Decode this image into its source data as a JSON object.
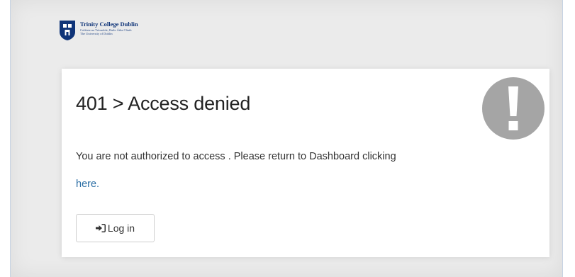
{
  "brand": {
    "name": "Trinity College Dublin",
    "irish_name": "Coláiste na Tríonóide, Baile Átha Cliath",
    "subtitle": "The University of Dublin",
    "color": "#0f3478"
  },
  "error": {
    "title": "401 > Access denied",
    "icon": "exclamation-circle-icon",
    "icon_color": "#a5a5a5",
    "message": "You are not authorized to access . Please return to Dashboard clicking",
    "link_text": "here.",
    "link_color": "#2b6ea4"
  },
  "login_button": {
    "label": "Log in",
    "icon": "sign-in-icon"
  }
}
